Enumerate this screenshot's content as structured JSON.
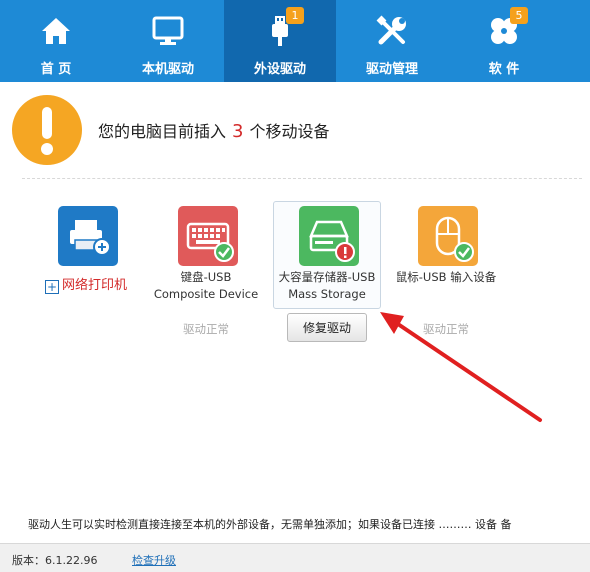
{
  "nav": {
    "items": [
      {
        "label": "首 页",
        "icon": "home-icon"
      },
      {
        "label": "本机驱动",
        "icon": "monitor-icon"
      },
      {
        "label": "外设驱动",
        "icon": "usb-icon",
        "badge": "1"
      },
      {
        "label": "驱动管理",
        "icon": "tools-icon"
      },
      {
        "label": "软 件",
        "icon": "clover-icon",
        "badge": "5"
      }
    ],
    "active_index": 2
  },
  "alert": {
    "prefix": "您的电脑目前插入",
    "count": "3",
    "suffix": "个移动设备"
  },
  "devices": [
    {
      "name": "网络打印机",
      "icon": "printer-icon",
      "color": "#1f7ac6"
    },
    {
      "name_line1": "键盘-USB",
      "name_line2": "Composite Device",
      "status": "驱动正常",
      "icon": "keyboard-icon",
      "color": "#e05a5a"
    },
    {
      "name_line1": "大容量存储器-USB",
      "name_line2": "Mass Storage",
      "action": "修复驱动",
      "icon": "storage-icon",
      "color": "#4cb860"
    },
    {
      "name_line1": "鼠标-USB 输入设备",
      "status": "驱动正常",
      "icon": "mouse-icon",
      "color": "#f4a63a"
    }
  ],
  "footer": {
    "note": "驱动人生可以实时检测直接连接至本机的外部设备，无需单独添加；如果设备已连接 ……… 设备  备",
    "version": "版本：6.1.22.96",
    "update_link": "检查升级"
  },
  "colors": {
    "nav_bg": "#1e8ad6",
    "nav_active": "#1168ae",
    "badge": "#f5a11c",
    "alert": "#f5a623",
    "count_red": "#d32a2a",
    "arrow_red": "#e02020"
  }
}
